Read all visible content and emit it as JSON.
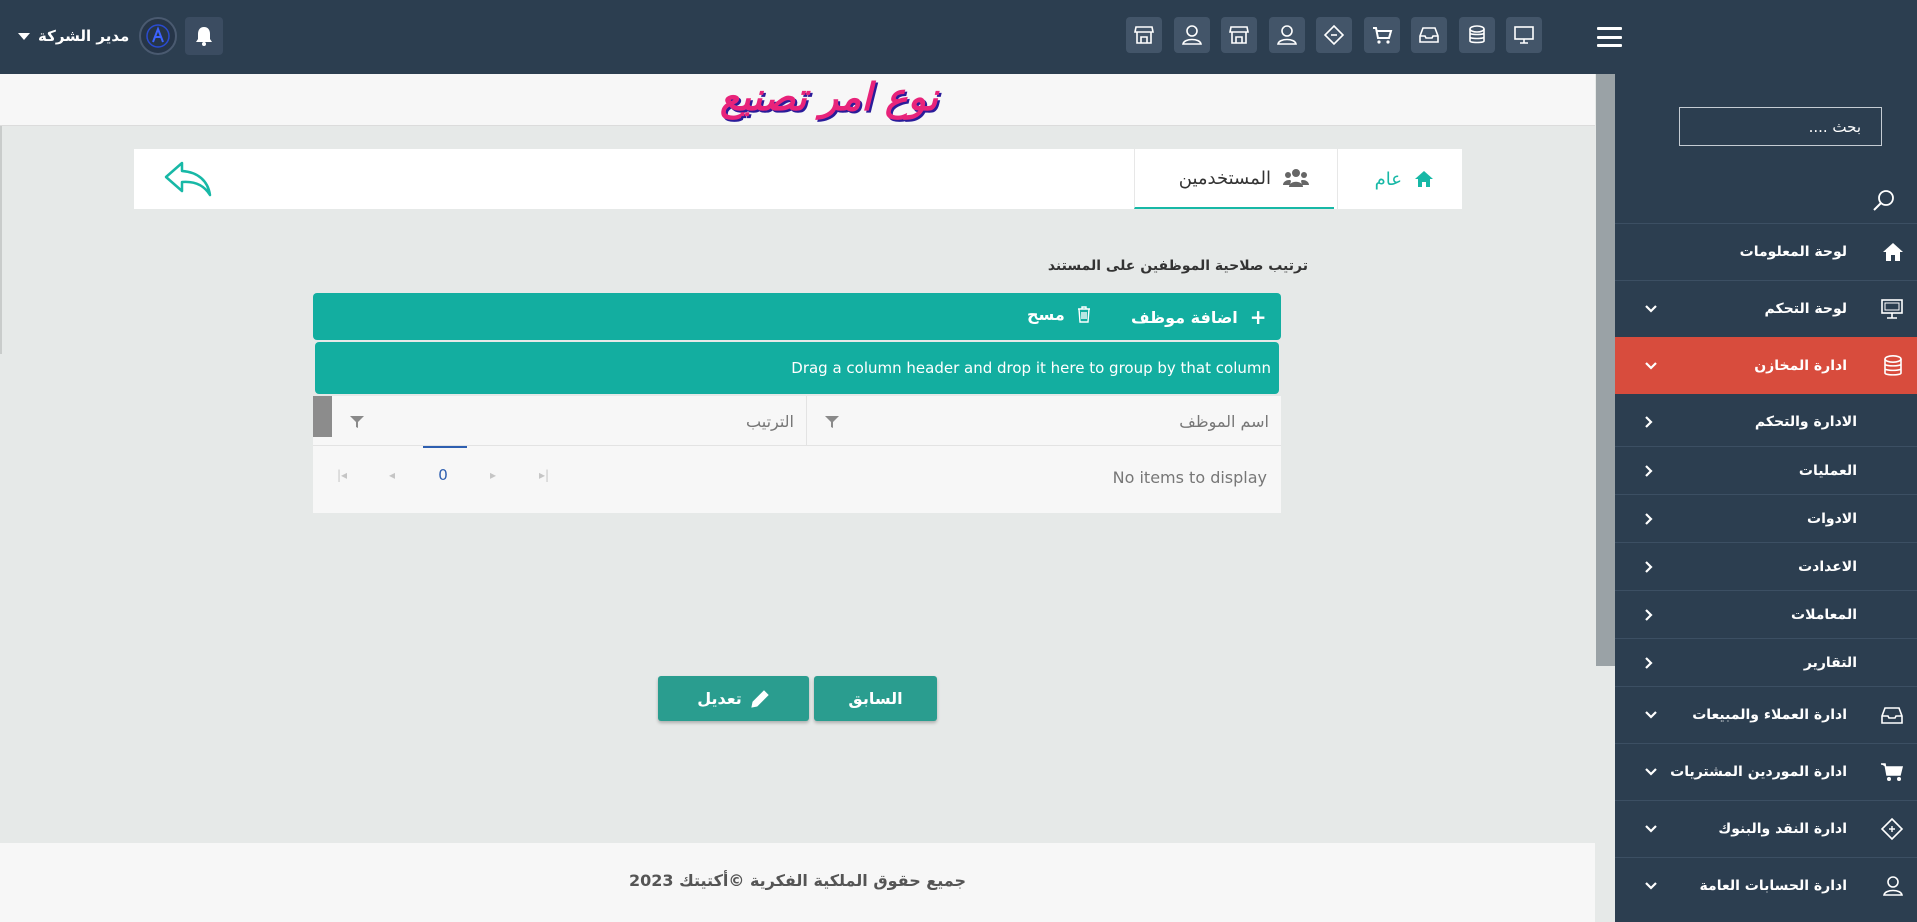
{
  "topbar": {
    "user_name": "مدير الشركة",
    "avatar_letter": "A"
  },
  "page_title": "نوع امر تصنيع",
  "tabs": {
    "general": "عام",
    "users": "المستخدمين"
  },
  "section_label": "ترتيب صلاحية الموظفين على المستند",
  "grid": {
    "add_label": "اضافة موظف",
    "delete_label": "مسح",
    "group_panel_text": "Drag a column header and drop it here to group by that column",
    "col_employee": "اسم الموظف",
    "col_order": "الترتيب",
    "no_items": "No items to display",
    "page_number": "0"
  },
  "buttons": {
    "previous": "السابق",
    "edit": "تعديل"
  },
  "footer": {
    "text": "جميع حقوق الملكية الفكرية ©أكتيتك 2023"
  },
  "sidebar": {
    "search_placeholder": "بحث ....",
    "items": {
      "dashboard": "لوحة المعلومات",
      "control_panel": "لوحة التحكم",
      "warehouses": "ادارة المخازن",
      "admin_control": "الادارة والتحكم",
      "operations": "العمليات",
      "tools": "الادوات",
      "settings": "الاعدادت",
      "transactions": "المعاملات",
      "reports": "التقارير",
      "customers_sales": "ادارة العملاء والمبيعات",
      "suppliers_purchases": "ادارة الموردين المشتريات",
      "cash_banks": "ادارة النقد والبنوك",
      "general_accounts": "ادارة الحسابات العامة"
    }
  },
  "colors": {
    "topbar": "#2c3e50",
    "accent": "#13aea0",
    "active_nav": "#d84c3d",
    "title": "#e8237a"
  }
}
